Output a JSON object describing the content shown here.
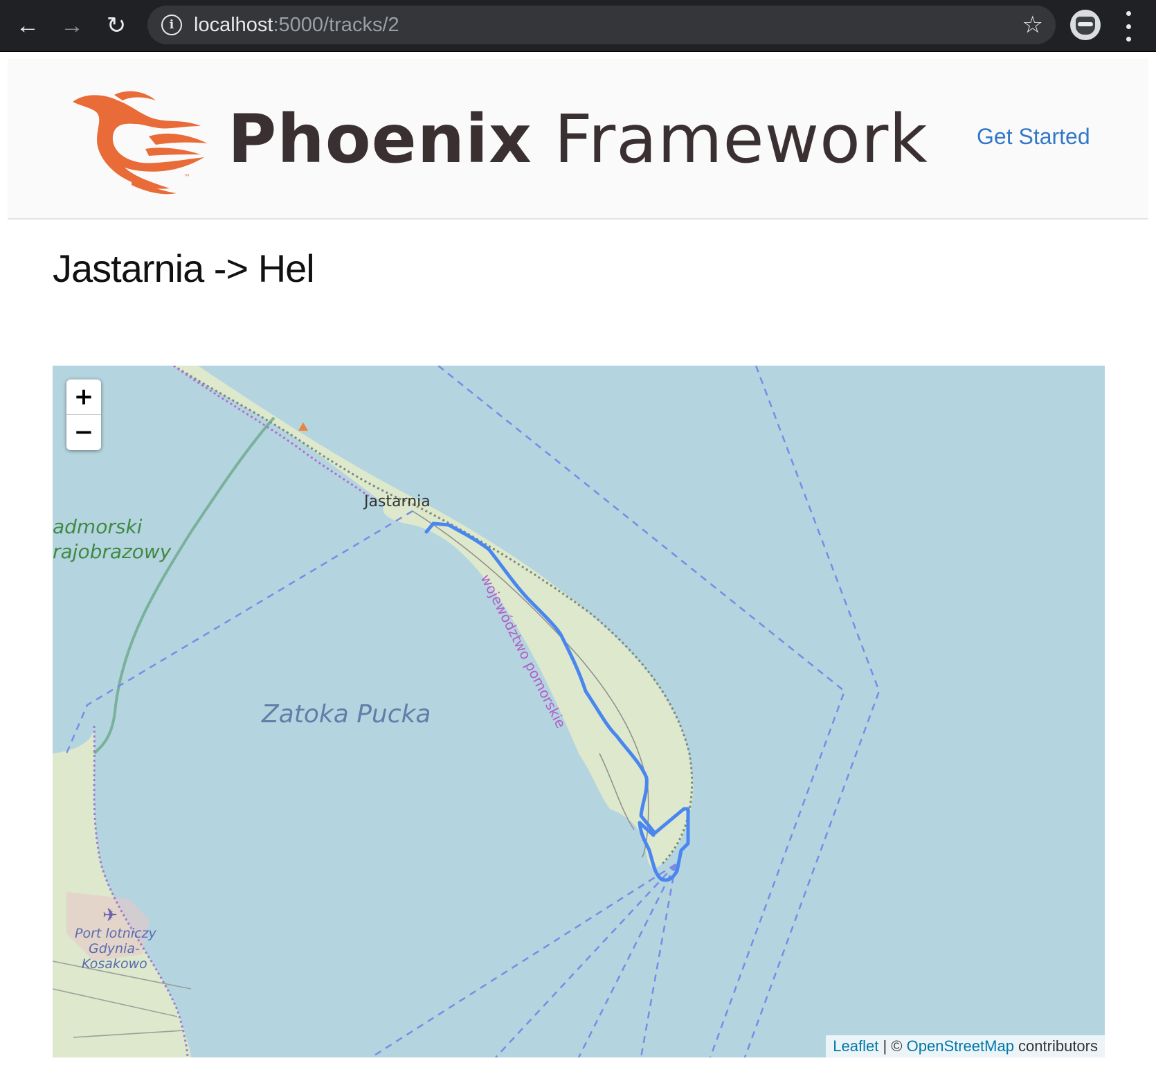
{
  "browser": {
    "url_host": "localhost",
    "url_rest": ":5000/tracks/2",
    "back_icon": "arrow-left-icon",
    "forward_icon": "arrow-right-icon",
    "reload_icon": "reload-icon",
    "info_icon": "info-icon",
    "bookmark_icon": "star-icon",
    "menu_icon": "kebab-menu-icon"
  },
  "header": {
    "logo_bold": "Phoenix",
    "logo_light": " Framework",
    "logo_mark": "™",
    "nav_link": "Get Started",
    "link_color": "#3277c8",
    "logo_color": "#e96b38"
  },
  "page": {
    "title": "Jastarnia -> Hel"
  },
  "map": {
    "zoom_in": "+",
    "zoom_out": "−",
    "labels": {
      "town_jastarnia": "Jastarnia",
      "bay": "Zatoka Pucka",
      "park_line1": "admorski",
      "park_line2": "rajobrazowy",
      "province": "województwo pomorskie",
      "airport_line1": "Port lotniczy",
      "airport_line2": "Gdynia-",
      "airport_line3": "Kosakowo"
    },
    "attribution": {
      "leaflet": "Leaflet",
      "separator": " | © ",
      "osm": "OpenStreetMap",
      "contributors": " contributors"
    },
    "colors": {
      "water": "#b4d4df",
      "land": "#dde8cc",
      "track": "#4a86f0",
      "boundary": "#9b7fd0"
    }
  }
}
